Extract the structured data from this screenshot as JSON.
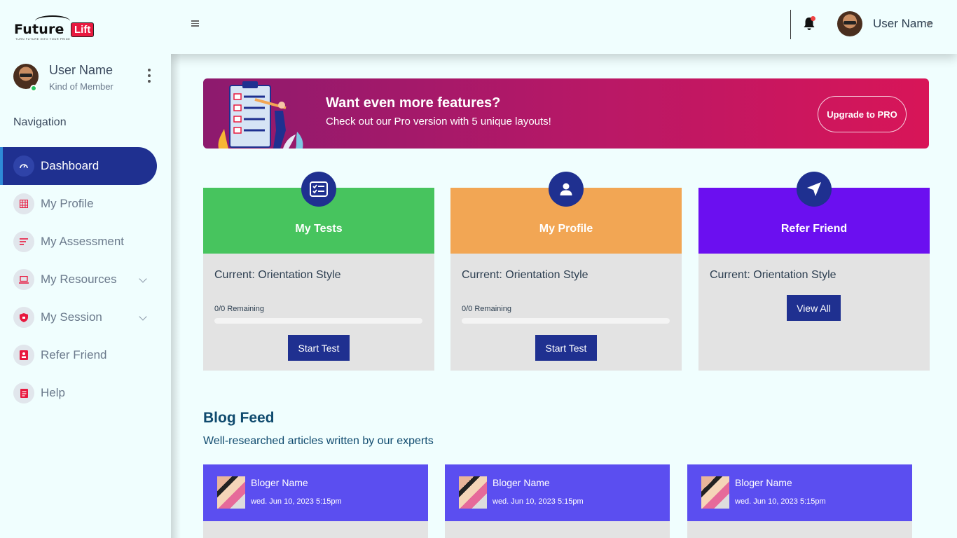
{
  "brand": {
    "word1": "Future",
    "word2": "Lift",
    "tagline": "TURN FUTURE INTO YOUR PRIDE"
  },
  "sidebar": {
    "user": {
      "name": "User Name",
      "role": "Kind of Member"
    },
    "nav_heading": "Navigation",
    "items": [
      {
        "label": "Dashboard",
        "icon": "speedometer-icon",
        "active": true,
        "has_submenu": false
      },
      {
        "label": "My Profile",
        "icon": "grid-icon",
        "active": false,
        "has_submenu": false
      },
      {
        "label": "My Assessment",
        "icon": "list-icon",
        "active": false,
        "has_submenu": false
      },
      {
        "label": "My Resources",
        "icon": "laptop-icon",
        "active": false,
        "has_submenu": true
      },
      {
        "label": "My Session",
        "icon": "shield-icon",
        "active": false,
        "has_submenu": true
      },
      {
        "label": "Refer Friend",
        "icon": "contact-card-icon",
        "active": false,
        "has_submenu": false
      },
      {
        "label": "Help",
        "icon": "document-icon",
        "active": false,
        "has_submenu": false
      }
    ]
  },
  "topbar": {
    "username": "User Name",
    "has_notification": true
  },
  "banner": {
    "title": "Want even more features?",
    "subtitle": "Check out our Pro version with 5 unique layouts!",
    "button": "Upgrade to PRO"
  },
  "cards": [
    {
      "title": "My Tests",
      "color": "#47c45e",
      "icon": "checklist-icon",
      "current": "Current: Orientation Style",
      "remaining": "0/0 Remaining",
      "progress": 0,
      "button": "Start Test"
    },
    {
      "title": "My Profile",
      "color": "#f2a654",
      "icon": "user-icon",
      "current": "Current: Orientation Style",
      "remaining": "0/0 Remaining",
      "progress": 0,
      "button": "Start Test"
    },
    {
      "title": "Refer Friend",
      "color": "#6b0ff0",
      "icon": "send-icon",
      "current": "Current: Orientation Style",
      "button": "View All"
    }
  ],
  "blog": {
    "title": "Blog Feed",
    "subtitle": "Well-researched articles written by our experts",
    "posts": [
      {
        "author": "Bloger Name",
        "date": "wed. Jun 10, 2023 5:15pm"
      },
      {
        "author": "Bloger Name",
        "date": "wed. Jun 10, 2023 5:15pm"
      },
      {
        "author": "Bloger Name",
        "date": "wed. Jun 10, 2023 5:15pm"
      }
    ]
  },
  "colors": {
    "primary": "#1f3090",
    "accent": "#2e8bd8",
    "banner_start": "#8d1a6e",
    "banner_end": "#d81558",
    "blog_header": "#5b4ef0",
    "background": "#f0fefe"
  }
}
